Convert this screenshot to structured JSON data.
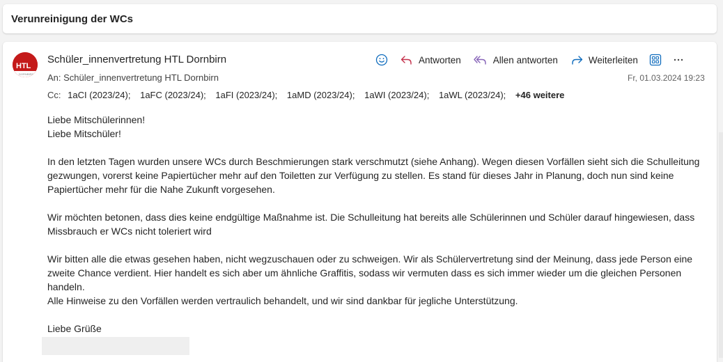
{
  "subject": "Verunreinigung der WCs",
  "avatar": {
    "text": "HTL",
    "subtext": "DORNBIRN",
    "color": "#c41a1a"
  },
  "sender": "Schüler_innenvertretung HTL Dornbirn",
  "to": {
    "prefix": "An:",
    "value": "Schüler_innenvertretung HTL Dornbirn"
  },
  "cc": {
    "prefix": "Cc:",
    "items": [
      "1aCI (2023/24);",
      "1aFC (2023/24);",
      "1aFI (2023/24);",
      "1aMD (2023/24);",
      "1aWI (2023/24);",
      "1aWL (2023/24);"
    ],
    "more": "+46 weitere"
  },
  "toolbar": {
    "emoji_icon": "emoji-icon",
    "reply": "Antworten",
    "reply_all": "Allen antworten",
    "forward": "Weiterleiten",
    "grid_icon": "grid-icon",
    "more_icon": "more-icon"
  },
  "date": "Fr, 01.03.2024 19:23",
  "body": {
    "greeting1": "Liebe Mitschülerinnen!",
    "greeting2": "Liebe Mitschüler!",
    "p1": "In den letzten Tagen wurden unsere WCs durch Beschmierungen stark verschmutzt (siehe Anhang). Wegen diesen Vorfällen sieht sich die Schulleitung gezwungen, vorerst keine Papiertücher mehr auf den Toiletten zur Verfügung zu stellen. Es stand für dieses Jahr in Planung, doch nun sind keine Papiertücher mehr für die Nahe Zukunft vorgesehen.",
    "p2": "Wir möchten betonen, dass dies keine endgültige Maßnahme ist. Die Schulleitung hat bereits alle Schülerinnen und Schüler darauf hingewiesen, dass Missbrauch er WCs nicht toleriert wird",
    "p3": "Wir bitten alle die etwas gesehen haben, nicht wegzuschauen oder zu schweigen. Wir als Schülervertretung sind der Meinung, dass jede Person eine zweite Chance verdient. Hier handelt es sich aber um ähnliche Graffitis, sodass wir vermuten dass es sich immer wieder um die gleichen Personen handeln.",
    "p4": "Alle Hinweise zu den Vorfällen werden vertraulich behandelt, und wir sind dankbar für jegliche Unterstützung.",
    "closing": "Liebe Grüße"
  },
  "colors": {
    "accent": "#0f6cbd",
    "avatar_red": "#c41a1a"
  }
}
